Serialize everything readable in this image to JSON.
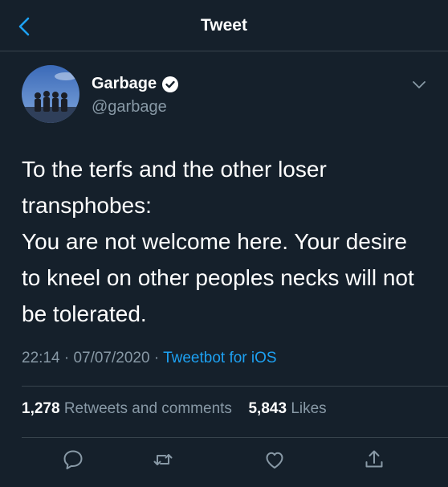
{
  "header": {
    "title": "Tweet"
  },
  "author": {
    "name": "Garbage",
    "handle": "@garbage"
  },
  "tweet": {
    "lines": [
      "To the terfs and the other loser transphobes:",
      "You are not welcome here. Your desire to kneel on other peoples necks will not be tolerated."
    ],
    "time": "22:14",
    "date": "07/07/2020",
    "source": "Tweetbot for iOS"
  },
  "stats": {
    "retweets_count": "1,278",
    "retweets_label": "Retweets and comments",
    "likes_count": "5,843",
    "likes_label": "Likes"
  },
  "colors": {
    "background": "#15202b",
    "accent": "#1da1f2",
    "secondary_text": "#8899a6",
    "divider": "#38444d"
  },
  "icons": [
    "back-icon",
    "verified-icon",
    "chevron-down-icon",
    "reply-icon",
    "retweet-icon",
    "like-icon",
    "share-icon"
  ]
}
